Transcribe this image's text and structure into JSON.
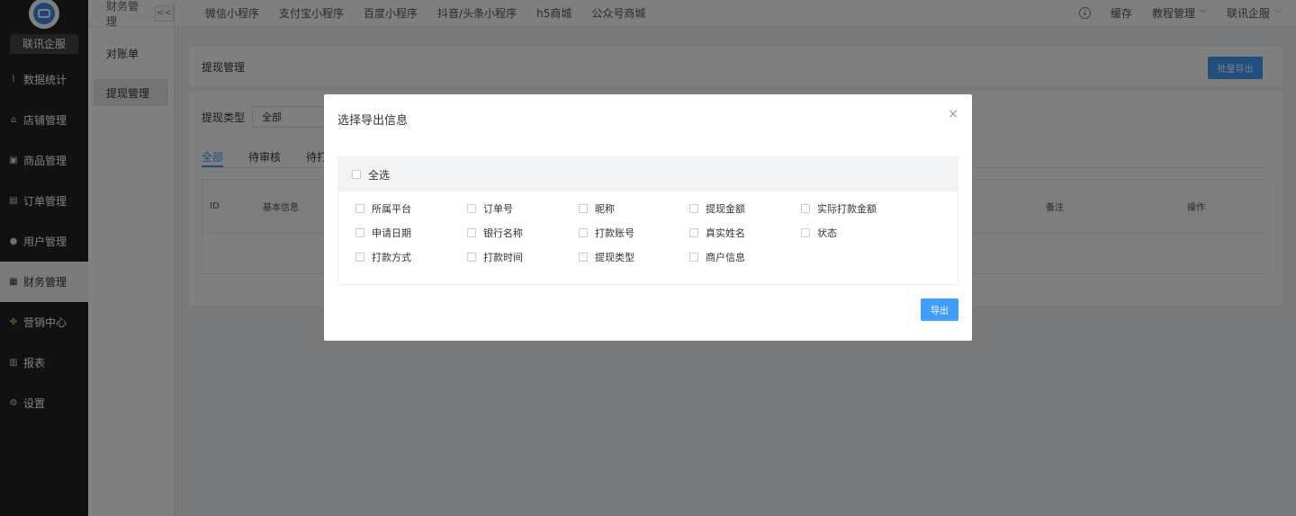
{
  "sidebar": {
    "brand": "联讯企服",
    "items": [
      {
        "label": "数据统计",
        "icon": "chart-line-icon"
      },
      {
        "label": "店铺管理",
        "icon": "store-icon"
      },
      {
        "label": "商品管理",
        "icon": "goods-icon"
      },
      {
        "label": "订单管理",
        "icon": "order-icon"
      },
      {
        "label": "用户管理",
        "icon": "user-icon"
      },
      {
        "label": "财务管理",
        "icon": "finance-icon"
      },
      {
        "label": "营销中心",
        "icon": "marketing-icon"
      },
      {
        "label": "报表",
        "icon": "report-icon"
      },
      {
        "label": "设置",
        "icon": "settings-icon"
      }
    ]
  },
  "subnav": {
    "header": "财务管理",
    "collapse": "<<",
    "items": [
      "对账单",
      "提现管理"
    ]
  },
  "topbar": {
    "tabs": [
      "微信小程序",
      "支付宝小程序",
      "百度小程序",
      "抖音/头条小程序",
      "h5商城",
      "公众号商城"
    ],
    "cache": "缓存",
    "tutorial": "教程管理",
    "company": "联讯企服"
  },
  "content": {
    "page_title": "提现管理",
    "batch_export": "批量导出",
    "filter_label": "提现类型",
    "filter_value": "全部",
    "status_tabs": [
      "全部",
      "待审核",
      "待打"
    ],
    "table_headers": [
      "ID",
      "基本信息",
      "备注",
      "操作"
    ]
  },
  "modal": {
    "title": "选择导出信息",
    "select_all": "全选",
    "options": [
      "所属平台",
      "订单号",
      "昵称",
      "提现金额",
      "实际打款金额",
      "申请日期",
      "银行名称",
      "打款账号",
      "真实姓名",
      "状态",
      "打款方式",
      "打款时间",
      "提现类型",
      "商户信息"
    ],
    "export": "导出"
  },
  "colors": {
    "accent": "#409eff",
    "sidebar_bg": "#222222"
  }
}
